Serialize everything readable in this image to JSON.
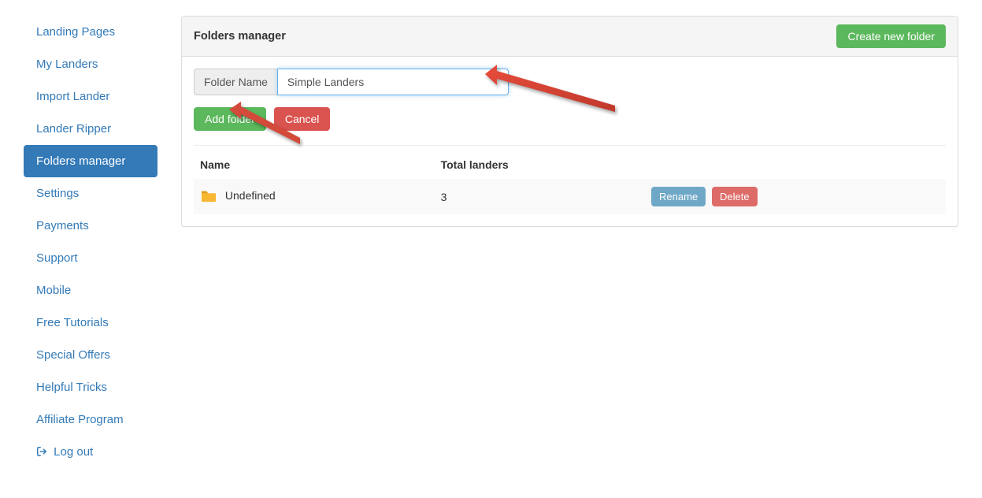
{
  "sidebar": {
    "items": [
      {
        "label": "Landing Pages",
        "active": false
      },
      {
        "label": "My Landers",
        "active": false
      },
      {
        "label": "Import Lander",
        "active": false
      },
      {
        "label": "Lander Ripper",
        "active": false
      },
      {
        "label": "Folders manager",
        "active": true
      },
      {
        "label": "Settings",
        "active": false
      },
      {
        "label": "Payments",
        "active": false
      },
      {
        "label": "Support",
        "active": false
      },
      {
        "label": "Mobile",
        "active": false
      },
      {
        "label": "Free Tutorials",
        "active": false
      },
      {
        "label": "Special Offers",
        "active": false
      },
      {
        "label": "Helpful Tricks",
        "active": false
      },
      {
        "label": "Affiliate Program",
        "active": false
      }
    ],
    "logout_label": "Log out"
  },
  "panel": {
    "title": "Folders manager",
    "create_button": "Create new folder"
  },
  "form": {
    "addon_label": "Folder Name",
    "input_value": "Simple Landers",
    "add_button": "Add folder",
    "cancel_button": "Cancel"
  },
  "table": {
    "headers": {
      "name": "Name",
      "total": "Total landers"
    },
    "rows": [
      {
        "name": "Undefined",
        "total": "3"
      }
    ],
    "row_actions": {
      "rename": "Rename",
      "delete": "Delete"
    }
  }
}
